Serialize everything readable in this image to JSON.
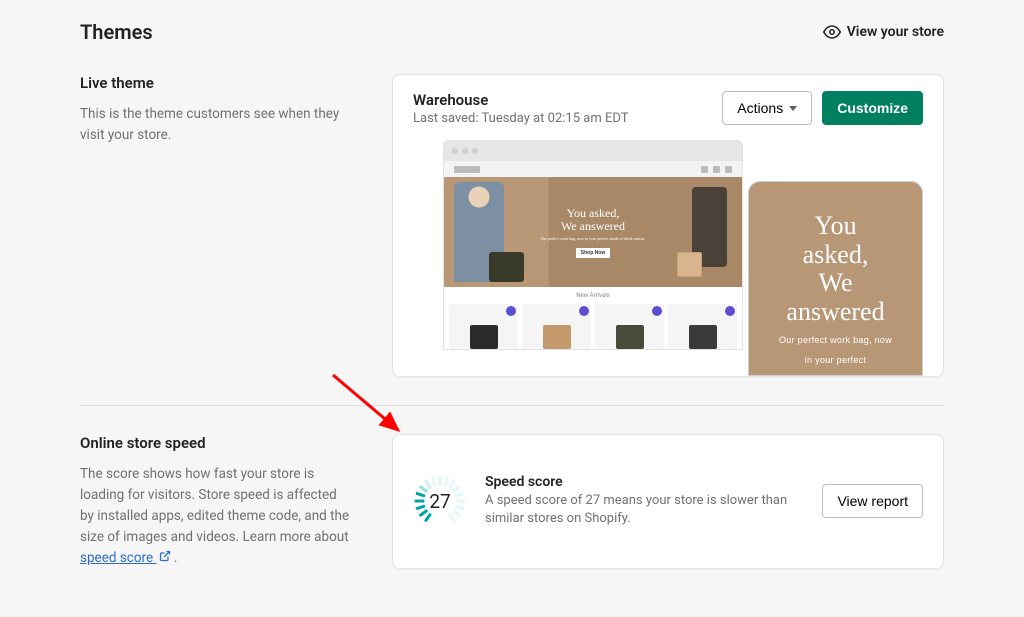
{
  "header": {
    "title": "Themes",
    "viewStore": "View your store"
  },
  "liveTheme": {
    "heading": "Live theme",
    "description": "This is the theme customers see when they visit your store.",
    "themeName": "Warehouse",
    "lastSaved": "Last saved: Tuesday at 02:15 am EDT",
    "actionsLabel": "Actions",
    "customizeLabel": "Customize",
    "heroLine1": "You asked,",
    "heroLine2": "We answered",
    "heroSub": "Our perfect work bag, now in your perfect shade of black canvas.",
    "shopNow": "Shop Now",
    "newArrivals": "New Arrivals",
    "mobileLine1": "You",
    "mobileLine2": "asked,",
    "mobileLine3": "We",
    "mobileLine4": "answered",
    "mobileSub1": "Our perfect work bag, now",
    "mobileSub2": "in your perfect"
  },
  "speed": {
    "heading": "Online store speed",
    "description": "The score shows how fast your store is loading for visitors. Store speed is affected by installed apps, edited theme code, and the size of images and videos. Learn more about ",
    "linkText": "speed score",
    "score": "27",
    "scoreTitle": "Speed score",
    "scoreDesc": "A speed score of 27 means your store is slower than similar stores on Shopify.",
    "viewReport": "View report"
  }
}
